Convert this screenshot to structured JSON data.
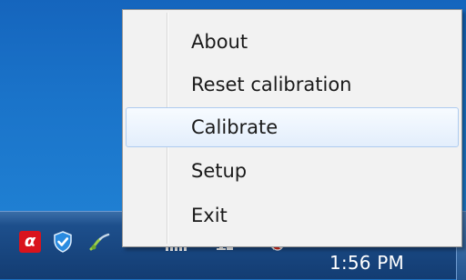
{
  "context_menu": {
    "items": [
      {
        "label": "About"
      },
      {
        "label": "Reset calibration"
      },
      {
        "label": "Calibrate",
        "highlighted": true
      },
      {
        "label": "Setup"
      },
      {
        "label": "Exit"
      }
    ]
  },
  "taskbar": {
    "clock": "1:56 PM",
    "tray_icons": [
      "avira-umbrella-icon",
      "shield-icon",
      "network-icon",
      "signal-bars-icon",
      "display-icon",
      "volume-muted-icon"
    ]
  },
  "colors": {
    "desktop": "#1a73c9",
    "taskbar": "#1d4f8c",
    "menu_background": "#f2f2f2",
    "menu_highlight_border": "#aecbef",
    "avira_red": "#d9131c"
  }
}
